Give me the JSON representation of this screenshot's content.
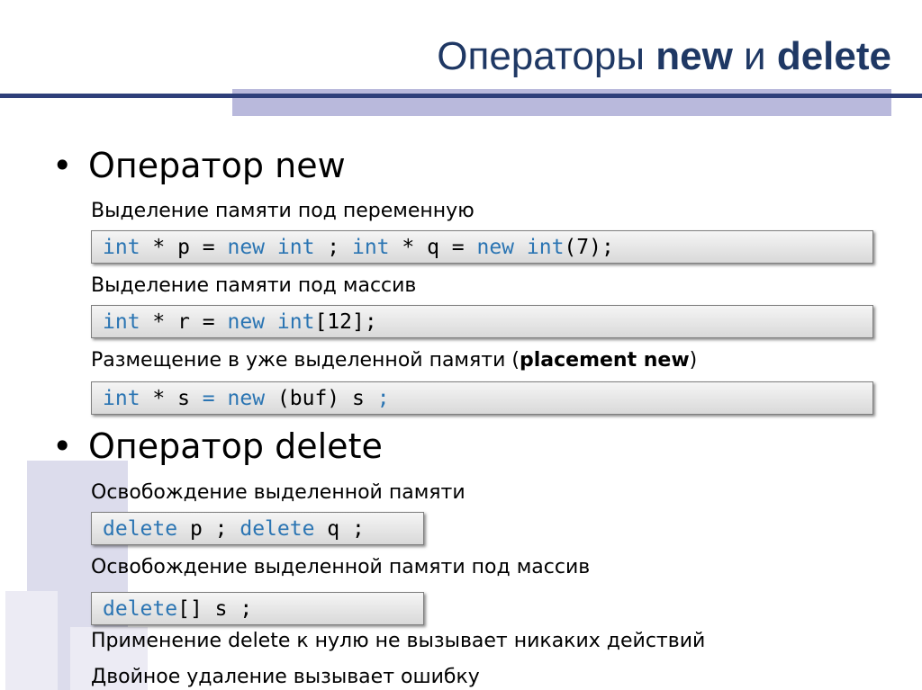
{
  "slide": {
    "title_part1": "Операторы ",
    "title_kw1": "new",
    "title_part2": " и ",
    "title_kw2": "delete"
  },
  "bullets": {
    "bullet_symbol": "•",
    "new_heading": "Оператор new",
    "delete_heading": "Оператор delete"
  },
  "new_section": {
    "var_alloc_label": "Выделение памяти под переменную",
    "array_alloc_label": "Выделение памяти под массив",
    "placement_label_prefix": "Размещение в уже выделенной памяти (",
    "placement_label_bold": "placement new",
    "placement_label_suffix": ")"
  },
  "delete_section": {
    "free_label": "Освобождение выделенной памяти",
    "free_array_label": "Освобождение выделенной памяти под массив",
    "null_note": "Применение delete к нулю не вызывает никаких действий",
    "double_note": "Двойное удаление вызывает ошибку"
  },
  "code": {
    "line1": [
      {
        "t": "int",
        "k": "kw"
      },
      {
        "t": " * p = ",
        "k": ""
      },
      {
        "t": "new",
        "k": "kw"
      },
      {
        "t": " ",
        "k": ""
      },
      {
        "t": "int",
        "k": "kw"
      },
      {
        "t": " ; ",
        "k": ""
      },
      {
        "t": "int",
        "k": "kw"
      },
      {
        "t": " * q = ",
        "k": ""
      },
      {
        "t": "new",
        "k": "kw"
      },
      {
        "t": " ",
        "k": ""
      },
      {
        "t": "int",
        "k": "kw"
      },
      {
        "t": "(7);",
        "k": ""
      }
    ],
    "line2": [
      {
        "t": "int",
        "k": "kw"
      },
      {
        "t": " * r = ",
        "k": ""
      },
      {
        "t": "new",
        "k": "kw"
      },
      {
        "t": " ",
        "k": ""
      },
      {
        "t": "int",
        "k": "kw"
      },
      {
        "t": "[12];",
        "k": ""
      }
    ],
    "line3": [
      {
        "t": "int",
        "k": "kw"
      },
      {
        "t": " * s ",
        "k": ""
      },
      {
        "t": "=",
        "k": "op"
      },
      {
        "t": " ",
        "k": ""
      },
      {
        "t": "new",
        "k": "kw"
      },
      {
        "t": " (buf) s ",
        "k": ""
      },
      {
        "t": ";",
        "k": "op"
      }
    ],
    "line4": [
      {
        "t": "delete",
        "k": "kw"
      },
      {
        "t": " p ; ",
        "k": ""
      },
      {
        "t": "delete",
        "k": "kw"
      },
      {
        "t": " q ;",
        "k": ""
      }
    ],
    "line5": [
      {
        "t": "delete",
        "k": "kw"
      },
      {
        "t": "[] s ;",
        "k": ""
      }
    ]
  },
  "colors": {
    "title": "#1f3864",
    "keyword": "#2b75b3",
    "rule_dark": "#2e3f7a",
    "rule_light": "#b9b9dc"
  }
}
